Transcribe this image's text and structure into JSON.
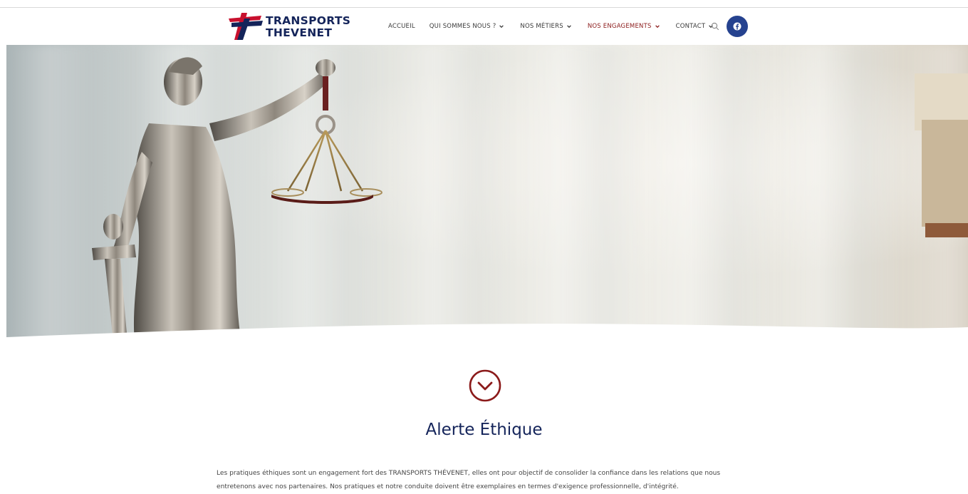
{
  "brand": {
    "line1": "TRANSPORTS",
    "line2": "THEVENET",
    "colors": {
      "navy": "#14245a",
      "red": "#c8102e"
    }
  },
  "nav": {
    "items": [
      {
        "label": "ACCUEIL",
        "dropdown": false,
        "active": false
      },
      {
        "label": "QUI SOMMES NOUS ?",
        "dropdown": true,
        "active": false
      },
      {
        "label": "NOS MÉTIERS",
        "dropdown": true,
        "active": false
      },
      {
        "label": "NOS ENGAGEMENTS",
        "dropdown": true,
        "active": true
      },
      {
        "label": "CONTACT",
        "dropdown": true,
        "active": false
      }
    ],
    "search_icon": "search-icon",
    "social_icon": "facebook-icon"
  },
  "hero": {
    "image": "lady-justice-statue"
  },
  "section": {
    "icon": "chevron-down-circle-icon",
    "title": "Alerte Éthique",
    "paragraph": "Les pratiques éthiques sont un engagement fort des TRANSPORTS THÉVENET, elles ont pour objectif de consolider la confiance dans les relations que nous entretenons avec nos partenaires. Nos pratiques et notre conduite doivent être exemplaires en termes d'exigence professionnelle, d'intégrité."
  },
  "colors": {
    "accent": "#8b1a1a",
    "title": "#14245a",
    "facebook": "#25428f"
  }
}
